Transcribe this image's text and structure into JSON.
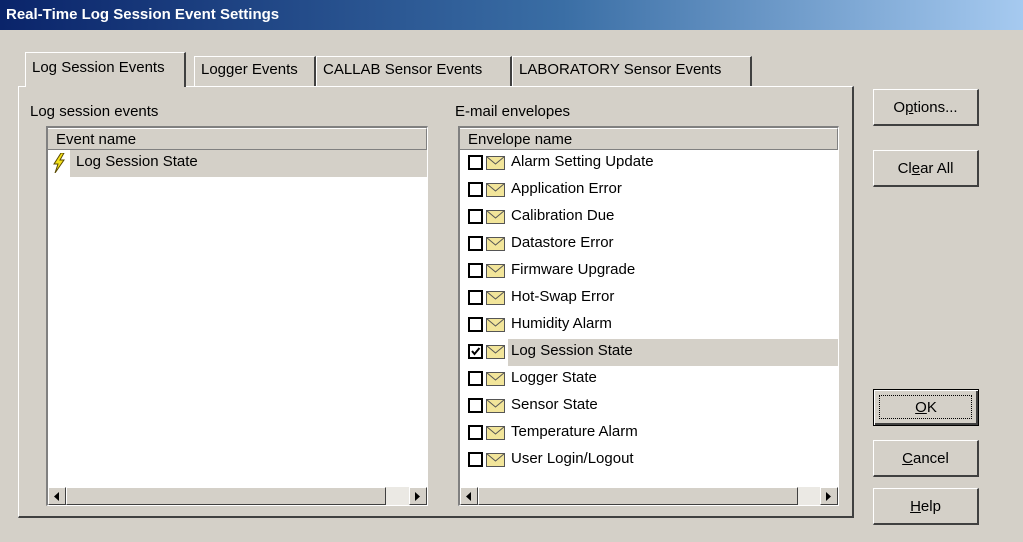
{
  "window": {
    "title": "Real-Time Log Session Event Settings"
  },
  "tabs": [
    {
      "label": "Log Session Events",
      "active": true
    },
    {
      "label": "Logger Events",
      "active": false
    },
    {
      "label": "CALLAB Sensor Events",
      "active": false
    },
    {
      "label": "LABORATORY Sensor Events",
      "active": false
    }
  ],
  "events_panel": {
    "group_label": "Log session events",
    "column_header": "Event name",
    "items": [
      {
        "label": "Log Session State",
        "icon": "lightning-bolt-icon",
        "selected": true
      }
    ]
  },
  "envelopes_panel": {
    "group_label": "E-mail envelopes",
    "column_header": "Envelope name",
    "items": [
      {
        "label": "Alarm Setting Update",
        "checked": false,
        "selected": false
      },
      {
        "label": "Application Error",
        "checked": false,
        "selected": false
      },
      {
        "label": "Calibration Due",
        "checked": false,
        "selected": false
      },
      {
        "label": "Datastore Error",
        "checked": false,
        "selected": false
      },
      {
        "label": "Firmware Upgrade",
        "checked": false,
        "selected": false
      },
      {
        "label": "Hot-Swap Error",
        "checked": false,
        "selected": false
      },
      {
        "label": "Humidity Alarm",
        "checked": false,
        "selected": false
      },
      {
        "label": "Log Session State",
        "checked": true,
        "selected": true
      },
      {
        "label": "Logger State",
        "checked": false,
        "selected": false
      },
      {
        "label": "Sensor State",
        "checked": false,
        "selected": false
      },
      {
        "label": "Temperature Alarm",
        "checked": false,
        "selected": false
      },
      {
        "label": "User Login/Logout",
        "checked": false,
        "selected": false
      }
    ]
  },
  "buttons": {
    "options": {
      "pre": "O",
      "key": "p",
      "post": "tions..."
    },
    "clear_all": {
      "pre": "Cl",
      "key": "e",
      "post": "ar All"
    },
    "ok": {
      "pre": "",
      "key": "O",
      "post": "K"
    },
    "cancel": {
      "pre": "",
      "key": "C",
      "post": "ancel"
    },
    "help": {
      "pre": "",
      "key": "H",
      "post": "elp"
    }
  },
  "colors": {
    "face": "#d4d0c8",
    "title_start": "#0a246a",
    "title_end": "#a6caf0",
    "envelope": "#f2e59a",
    "bolt": "#f5e219"
  }
}
